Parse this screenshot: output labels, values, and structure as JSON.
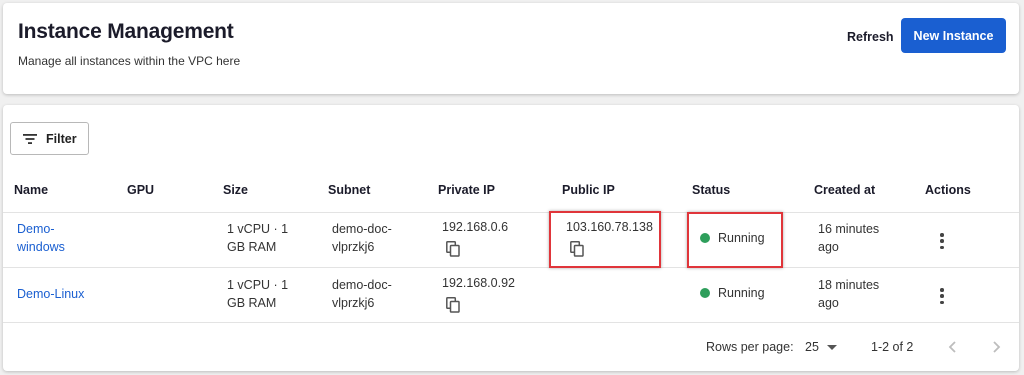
{
  "header": {
    "title": "Instance Management",
    "subtitle": "Manage all instances within the VPC here",
    "refresh_label": "Refresh",
    "new_instance_label": "New Instance"
  },
  "toolbar": {
    "filter_label": "Filter"
  },
  "table": {
    "columns": [
      "Name",
      "GPU",
      "Size",
      "Subnet",
      "Private IP",
      "Public IP",
      "Status",
      "Created at",
      "Actions"
    ],
    "rows": [
      {
        "name_line1": "Demo-",
        "name_line2": "windows",
        "gpu": "",
        "size_line1": "1 vCPU · 1",
        "size_line2": "GB RAM",
        "subnet_line1": "demo-doc-",
        "subnet_line2": "vlprzkj6",
        "private_ip": "192.168.0.6",
        "public_ip": "103.160.78.138",
        "status": "Running",
        "created_line1": "16 minutes",
        "created_line2": "ago"
      },
      {
        "name_line1": "Demo-Linux",
        "name_line2": "",
        "gpu": "",
        "size_line1": "1 vCPU · 1",
        "size_line2": "GB RAM",
        "subnet_line1": "demo-doc-",
        "subnet_line2": "vlprzkj6",
        "private_ip": "192.168.0.92",
        "public_ip": "",
        "status": "Running",
        "created_line1": "18 minutes",
        "created_line2": "ago"
      }
    ]
  },
  "pagination": {
    "rows_per_page_label": "Rows per page:",
    "rows_per_page_value": "25",
    "range_text": "1-2 of 2"
  },
  "colors": {
    "accent": "#1a5fd1",
    "status_running": "#2e9e5b",
    "highlight_box": "#e0353a"
  },
  "icons": [
    "filter-icon",
    "copy-icon",
    "more-vert-icon",
    "chevron-left-icon",
    "chevron-right-icon",
    "caret-down-icon"
  ]
}
